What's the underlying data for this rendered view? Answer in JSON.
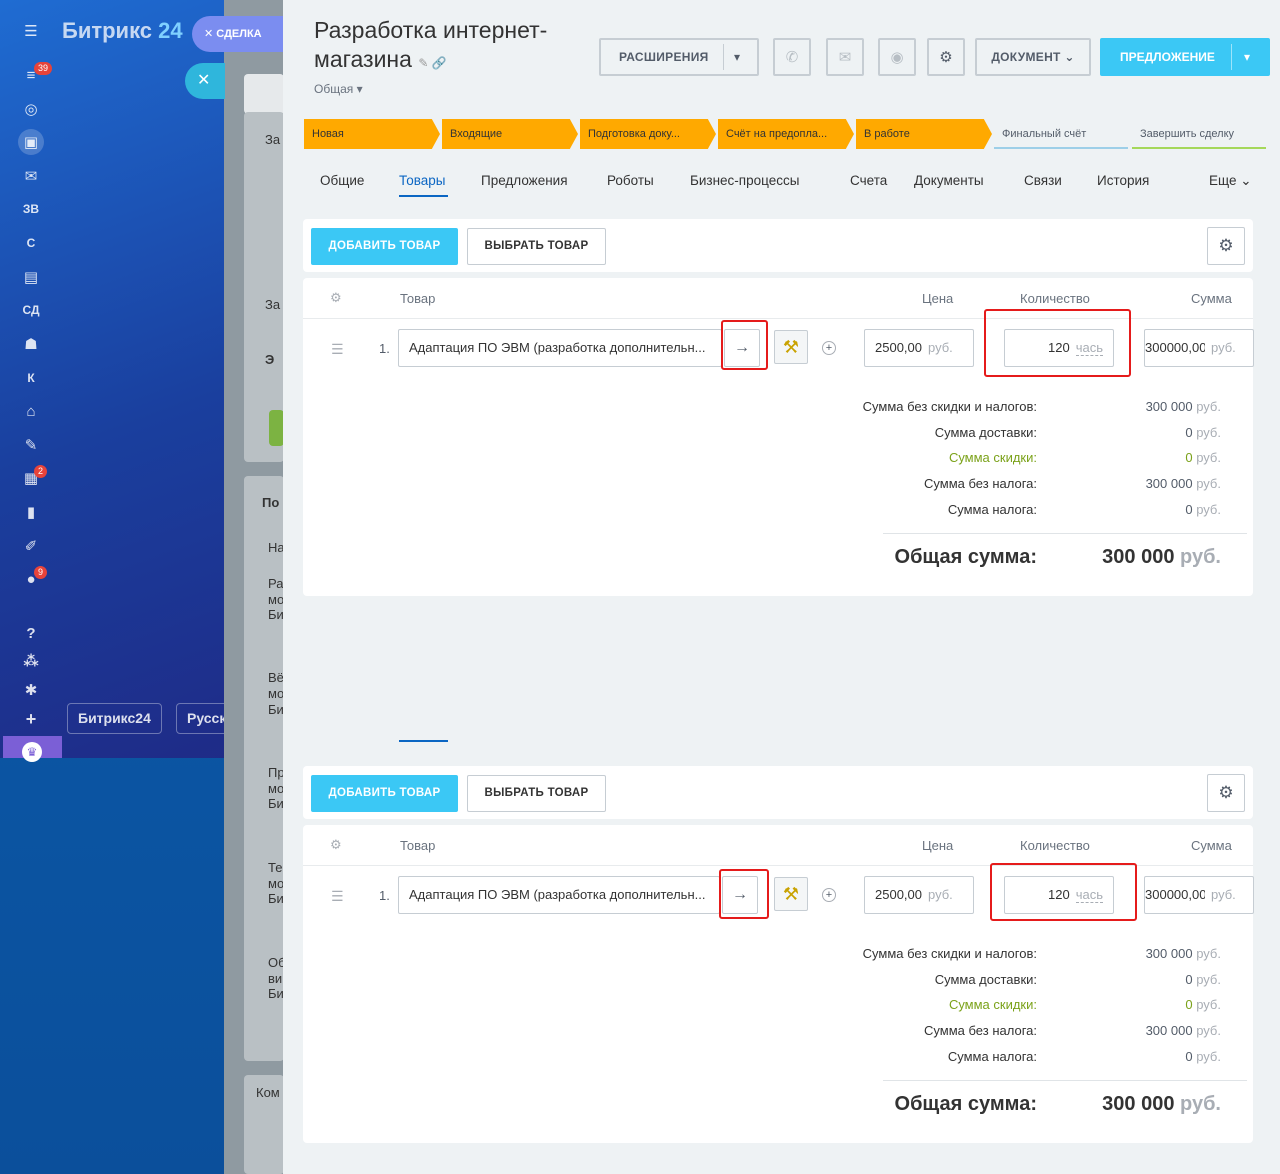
{
  "sidebar": {
    "brand_main": "Битрикс",
    "brand_num": "24",
    "badges": {
      "tasks": "39",
      "contacts": "2",
      "notifications": "9"
    },
    "letters": [
      "ЗВ",
      "С",
      "СД",
      "К"
    ],
    "bottom_brand": "Битрикс24",
    "lang": "Русск",
    "deal_chip": "СДЕЛКА",
    "behind_texts": [
      "За",
      "За",
      "Э",
      "По",
      "На",
      "Ра",
      "мо",
      "Би",
      "Вё",
      "мо",
      "Би",
      "Пр",
      "мо",
      "Би",
      "Те",
      "мо",
      "Би",
      "Об",
      "ви",
      "Би",
      "Ком"
    ]
  },
  "header": {
    "title": "Разработка интернет-магазина",
    "subtitle": "Общая",
    "btn_extensions": "РАСШИРЕНИЯ",
    "btn_document": "ДОКУМЕНТ",
    "btn_offer": "ПРЕДЛОЖЕНИЕ"
  },
  "stages": [
    {
      "label": "Новая",
      "active": true
    },
    {
      "label": "Входящие",
      "active": true
    },
    {
      "label": "Подготовка доку...",
      "active": true
    },
    {
      "label": "Счёт на предопла...",
      "active": true
    },
    {
      "label": "В работе",
      "active": true
    },
    {
      "label": "Финальный счёт",
      "active": false
    },
    {
      "label": "Завершить сделку",
      "active": false
    }
  ],
  "tabs": [
    "Общие",
    "Товары",
    "Предложения",
    "Роботы",
    "Бизнес-процессы",
    "Счета",
    "Документы",
    "Связи",
    "История",
    "Еще"
  ],
  "products": {
    "btn_add": "ДОБАВИТЬ ТОВАР",
    "btn_choose": "ВЫБРАТЬ ТОВАР",
    "col_product": "Товар",
    "col_price": "Цена",
    "col_qty": "Количество",
    "col_sum": "Сумма",
    "row": {
      "index": "1.",
      "name": "Адаптация ПО ЭВМ (разработка дополнительн...",
      "price": "2500,00",
      "price_unit": "руб.",
      "qty": "120",
      "qty_unit": "чась",
      "sum": "300000,00",
      "sum_unit": "руб."
    },
    "summary": [
      {
        "label": "Сумма без скидки и налогов:",
        "value": "300 000",
        "unit": "руб.",
        "green": false
      },
      {
        "label": "Сумма доставки:",
        "value": "0",
        "unit": "руб.",
        "green": false
      },
      {
        "label": "Сумма скидки:",
        "value": "0",
        "unit": "руб.",
        "green": true
      },
      {
        "label": "Сумма без налога:",
        "value": "300 000",
        "unit": "руб.",
        "green": false
      },
      {
        "label": "Сумма налога:",
        "value": "0",
        "unit": "руб.",
        "green": false
      }
    ],
    "total_label": "Общая сумма:",
    "total_value": "300 000",
    "total_unit": "руб."
  },
  "colors": {
    "accent": "#3bc8f5",
    "stage": "#ffa900",
    "highlight": "#e51b1b",
    "link": "#0b66c3"
  }
}
